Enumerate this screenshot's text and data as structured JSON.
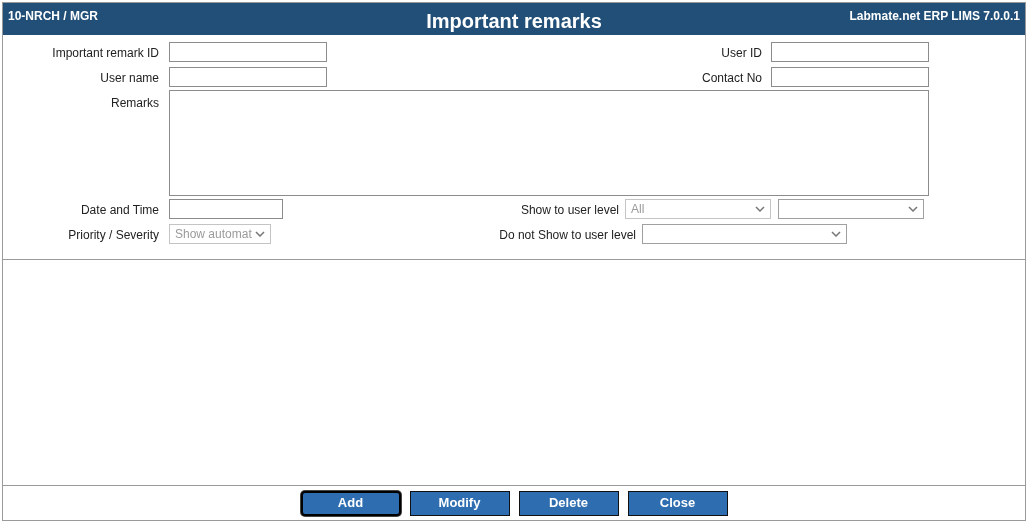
{
  "header": {
    "context": "10-NRCH / MGR",
    "title": "Important remarks",
    "product": "Labmate.net ERP LIMS 7.0.0.1"
  },
  "form": {
    "remark_id": {
      "label": "Important remark ID"
    },
    "user_id": {
      "label": "User ID"
    },
    "user_name": {
      "label": "User name"
    },
    "contact_no": {
      "label": "Contact No"
    },
    "remarks": {
      "label": "Remarks"
    },
    "date_time": {
      "label": "Date and Time"
    },
    "show_level": {
      "label": "Show to user level",
      "selects": [
        {
          "value": "All",
          "disabled": true
        },
        {
          "disabled": false
        }
      ]
    },
    "priority": {
      "label": "Priority / Severity",
      "value": "Show automat",
      "disabled": true
    },
    "hide_level": {
      "label": "Do not Show to user level",
      "disabled": false
    }
  },
  "buttons": [
    {
      "label": "Add",
      "focused": true
    },
    {
      "label": "Modify",
      "focused": false
    },
    {
      "label": "Delete",
      "focused": false
    },
    {
      "label": "Close",
      "focused": false
    }
  ]
}
